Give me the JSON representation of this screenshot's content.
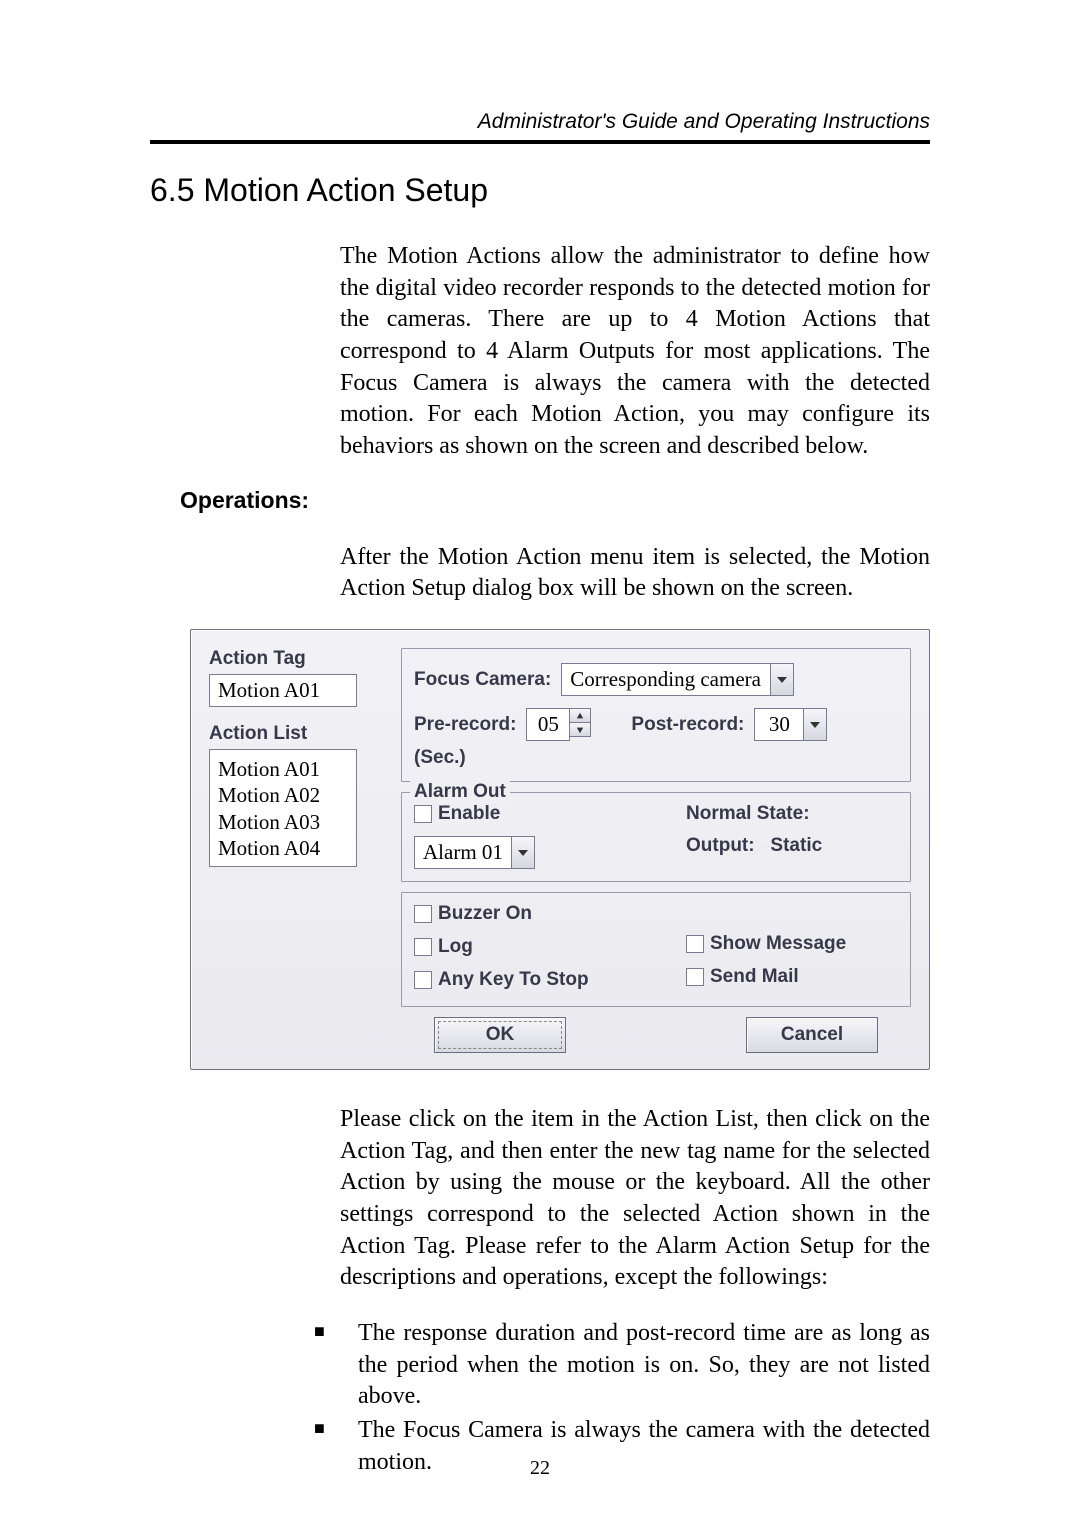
{
  "header": {
    "running_title": "Administrator's Guide and Operating Instructions"
  },
  "section": {
    "number_title": "6.5 Motion Action Setup",
    "intro": "The Motion Actions allow the administrator to define how the digital video recorder responds to the detected motion for the cameras. There are up to 4 Motion Actions that correspond to 4 Alarm Outputs for most applications.   The Focus Camera is always the camera with the detected motion.   For each Motion Action, you may configure its behaviors as shown on the screen and described below.",
    "operations_heading": "Operations:",
    "operations_intro": "After the Motion Action menu item is selected, the Motion Action Setup dialog box will be shown on the screen.",
    "after_dialog": "Please click on the item in the Action List, then click on the Action Tag, and then enter the new tag name for the selected Action by using the mouse or the keyboard.   All the other settings correspond to the selected Action shown in the Action Tag.   Please refer to the Alarm Action Setup for the descriptions and operations, except the followings:",
    "bullets": [
      "The response duration and post-record time are as long as the period when the motion is on.   So, they are not listed above.",
      "The Focus Camera is always the camera with the detected motion."
    ]
  },
  "dialog": {
    "action_tag_label": "Action Tag",
    "action_tag_value": "Motion A01",
    "action_list_label": "Action List",
    "action_list": [
      "Motion A01",
      "Motion A02",
      "Motion A03",
      "Motion A04"
    ],
    "focus_camera_label": "Focus Camera:",
    "focus_camera_value": "Corresponding camera",
    "pre_record_label": "Pre-record:",
    "pre_record_value": "05",
    "post_record_label": "Post-record:",
    "post_record_value": "30",
    "sec_label": "(Sec.)",
    "alarm_out_title": "Alarm Out",
    "enable_label": "Enable",
    "alarm_select_value": "Alarm 01",
    "normal_state_label": "Normal State:",
    "output_label": "Output:",
    "output_value": "Static",
    "buzzer_label": "Buzzer On",
    "log_label": "Log",
    "anykey_label": "Any Key To Stop",
    "showmsg_label": "Show Message",
    "sendmail_label": "Send Mail",
    "ok_label": "OK",
    "cancel_label": "Cancel"
  },
  "page_number": "22"
}
